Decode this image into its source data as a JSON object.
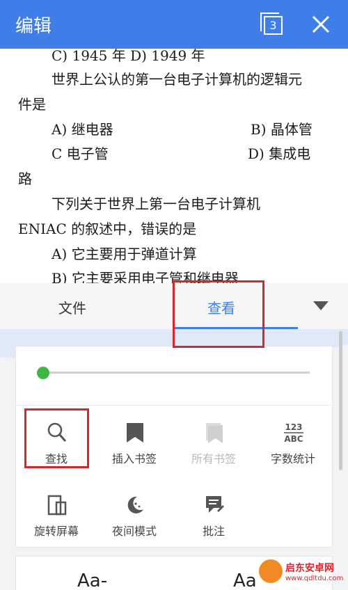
{
  "topbar": {
    "title": "编辑",
    "tab_count": "3"
  },
  "document": {
    "lines": [
      "C) 1945 年      D) 1949 年",
      "世界上公认的第一台电子计算机的逻辑元",
      "件是",
      "A)  继电器",
      "B)  晶体管",
      "C  电子管",
      "D)  集成电",
      "路",
      "下列关于世界上第一台电子计算机",
      "ENIAC 的叙述中，错误的是",
      "A)  它主要用于弹道计算",
      "B)  它主要采用电子管和继电器"
    ]
  },
  "panel": {
    "tabs": [
      {
        "label": "文件"
      },
      {
        "label": "查看"
      }
    ],
    "slider_value": 0,
    "tools": [
      {
        "label": "查找",
        "icon": "search-icon"
      },
      {
        "label": "插入书签",
        "icon": "bookmark-icon"
      },
      {
        "label": "所有书签",
        "icon": "bookmarks-icon"
      },
      {
        "label": "字数统计",
        "icon": "word-count-icon",
        "glyph_top": "123",
        "glyph_bottom": "ABC"
      },
      {
        "label": "旋转屏幕",
        "icon": "rotate-screen-icon"
      },
      {
        "label": "夜间模式",
        "icon": "night-mode-icon"
      },
      {
        "label": "批注",
        "icon": "comment-icon"
      }
    ],
    "font_small": "Aa-",
    "font_large": "Aa"
  },
  "watermark": {
    "text": "启东安卓网",
    "url": "www.qdltdu.com"
  },
  "colors": {
    "accent": "#3f7de8",
    "highlight": "#d8262b",
    "slider": "#3fb544"
  }
}
